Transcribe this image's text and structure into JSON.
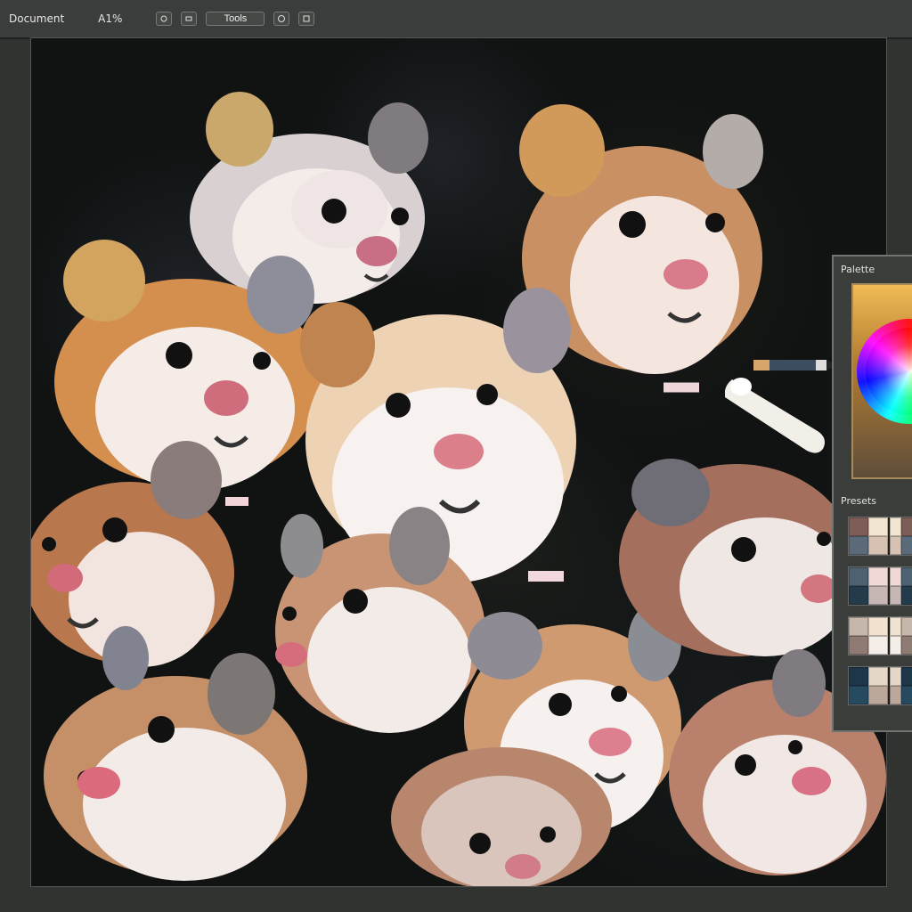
{
  "toolbar": {
    "title": "Document",
    "mode_label": "A1%",
    "buttons": [
      "Brush",
      "Eraser",
      "Tools",
      "Layers",
      "Save"
    ]
  },
  "panel": {
    "title": "Palette",
    "subtitle": "Presets",
    "accent_color": "#f1ba55",
    "swatches": [
      [
        "#7f5d57",
        "#f3e6d0",
        "#5a6a79",
        "#d6c1b2"
      ],
      [
        "#4d6170",
        "#f0d9d4",
        "#243b4c",
        "#c7b7b4"
      ],
      [
        "#c6b7aa",
        "#f1e3d0",
        "#8f7b73",
        "#f4ede8"
      ],
      [
        "#1d3649",
        "#e6d8c9",
        "#264a5f",
        "#bca79b"
      ]
    ]
  },
  "canvas": {
    "image_alt": "Group of realistic hamsters on a dark background"
  },
  "icons": {
    "color_wheel": "color-wheel-icon",
    "pencil": "pencil-icon",
    "stylus": "stylus-icon"
  }
}
